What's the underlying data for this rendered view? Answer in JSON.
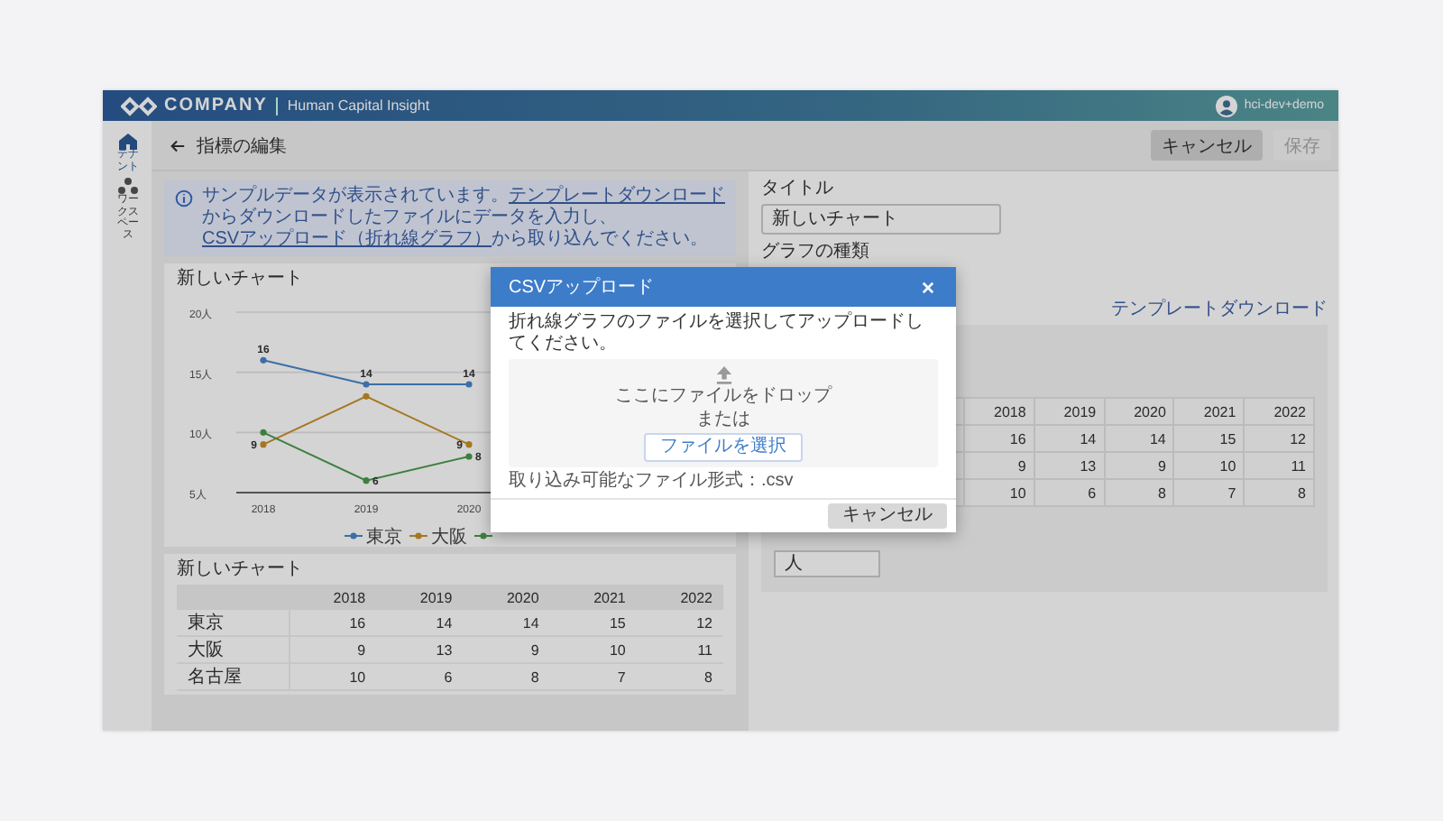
{
  "header": {
    "logo": "COMPANY",
    "product": "Human Capital Insight",
    "user": "hci-dev+demo"
  },
  "sidebar": [
    {
      "label": "テナント",
      "selected": true
    },
    {
      "label": "ワークスペース",
      "selected": false
    }
  ],
  "toolbar": {
    "title": "指標の編集",
    "buttons": [
      {
        "label": "キャンセル",
        "disabled": false
      },
      {
        "label": "保存",
        "disabled": true
      }
    ]
  },
  "info_banner": {
    "parts": [
      {
        "text": "サンプルデータが表示されています。",
        "link": false
      },
      {
        "text": "テンプレートダウンロード",
        "link": true
      },
      {
        "text": "からダウンロードしたファイルにデータを入力し、",
        "link": false
      },
      {
        "text": "CSVアップロード（折れ線グラフ）",
        "link": true
      },
      {
        "text": "から取り込んでください。",
        "link": false
      }
    ]
  },
  "chart_card": {
    "title": "新しいチャート",
    "chart_data": {
      "type": "line",
      "categories": [
        "2018",
        "2019",
        "2020"
      ],
      "ylim": [
        5,
        20
      ],
      "yticks": [
        {
          "value": 5,
          "label": "5人"
        },
        {
          "value": 10,
          "label": "10人"
        },
        {
          "value": 15,
          "label": "15人"
        },
        {
          "value": 20,
          "label": "20人"
        }
      ],
      "legend": "bottom",
      "series": [
        {
          "name": "東京",
          "color": "#4a86c8",
          "marker": "circle",
          "values": [
            16,
            14,
            14
          ],
          "value_labels": [
            "16",
            "14",
            "14"
          ]
        },
        {
          "name": "大阪",
          "color": "#c8902a",
          "marker": "circle",
          "values": [
            9,
            13,
            9
          ],
          "value_labels": [
            "9",
            null,
            "9"
          ]
        },
        {
          "color": "#4a9a4a",
          "marker": "circle",
          "values": [
            10,
            6,
            8
          ],
          "value_labels": [
            null,
            "6",
            "8"
          ]
        }
      ]
    }
  },
  "table_card": {
    "title": "新しいチャート",
    "columns": [
      "2018",
      "2019",
      "2020",
      "2021",
      "2022"
    ],
    "rows": [
      {
        "label": "東京",
        "cells": [
          "16",
          "14",
          "14",
          "15",
          "12"
        ]
      },
      {
        "label": "大阪",
        "cells": [
          "9",
          "13",
          "9",
          "10",
          "11"
        ]
      },
      {
        "label": "名古屋",
        "cells": [
          "10",
          "6",
          "8",
          "7",
          "8"
        ]
      }
    ]
  },
  "settings": {
    "title_label": "タイトル",
    "title_value": "新しいチャート",
    "chart_type_label": "グラフの種類",
    "template_link": "テンプレートダウンロード",
    "preview_table": {
      "columns": [
        "2018",
        "2019",
        "2020",
        "2021",
        "2022"
      ],
      "rows": [
        {
          "cells": [
            "16",
            "14",
            "14",
            "15",
            "12"
          ]
        },
        {
          "cells": [
            "9",
            "13",
            "9",
            "10",
            "11"
          ]
        },
        {
          "cells": [
            "10",
            "6",
            "8",
            "7",
            "8"
          ]
        }
      ]
    },
    "unit_value": "人"
  },
  "modal": {
    "title": "CSVアップロード",
    "instruction": "折れ線グラフのファイルを選択してアップロードしてください。",
    "drop_text": "ここにファイルをドロップ",
    "or_text": "または",
    "select_button": "ファイルを選択",
    "formats": "取り込み可能なファイル形式：.csv",
    "cancel": "キャンセル"
  }
}
